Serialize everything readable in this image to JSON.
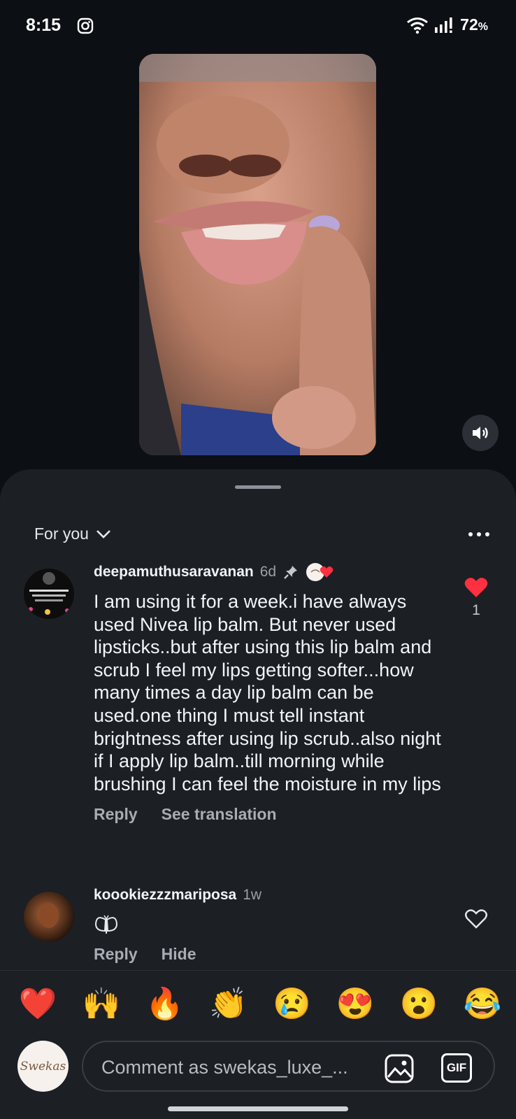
{
  "status_bar": {
    "time": "8:15",
    "battery": "72",
    "battery_unit": "%"
  },
  "sheet": {
    "sort_label": "For you",
    "comments": [
      {
        "username": "deepamuthusaravanan",
        "time": "6d",
        "text": "I am using it for a week.i have always used Nivea lip balm. But never used lipsticks..but after using this lip balm and scrub I feel my lips getting softer...how many times a day lip balm can be used.one thing I must tell instant brightness after using lip scrub..also night if I apply lip balm..till morning while brushing I can feel the moisture in my lips",
        "reply_label": "Reply",
        "translate_label": "See translation",
        "like_count": "1",
        "liked": true
      },
      {
        "username": "koookiezzzmariposa",
        "time": "1w",
        "reply_label": "Reply",
        "hide_label": "Hide",
        "liked": false
      }
    ]
  },
  "emoji_bar": [
    "❤️",
    "🙌",
    "🔥",
    "👏",
    "😢",
    "😍",
    "😮",
    "😂"
  ],
  "composer": {
    "avatar_text": "Swekas",
    "placeholder": "Comment as swekas_luxe_...",
    "gif_label": "GIF"
  },
  "colors": {
    "like_red": "#ff3040",
    "background": "#0c0f14",
    "sheet": "#1c1f24"
  }
}
